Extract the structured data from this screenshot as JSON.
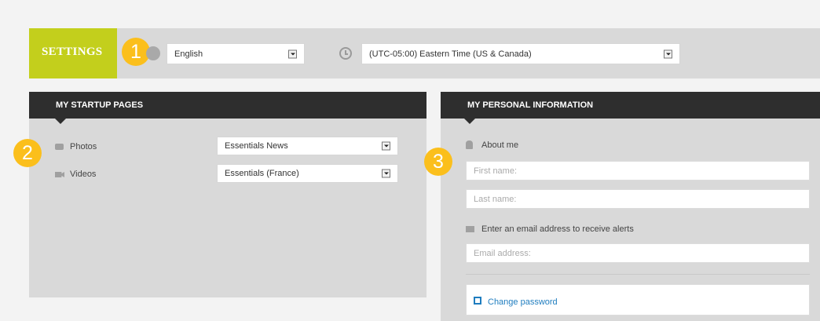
{
  "header": {
    "settings_label": "SETTINGS",
    "language": {
      "value": "English",
      "icon": "globe-icon"
    },
    "timezone": {
      "value": "(UTC-05:00) Eastern Time (US & Canada)",
      "icon": "clock-icon"
    }
  },
  "badges": [
    "1",
    "2",
    "3"
  ],
  "startup": {
    "title": "MY STARTUP PAGES",
    "rows": [
      {
        "label": "Photos",
        "icon": "camera-icon",
        "value": "Essentials News"
      },
      {
        "label": "Videos",
        "icon": "video-icon",
        "value": "Essentials (France)"
      }
    ]
  },
  "personal": {
    "title": "MY PERSONAL INFORMATION",
    "about_label": "About me",
    "first_name_placeholder": "First name:",
    "last_name_placeholder": "Last name:",
    "email_label": "Enter an email address to receive alerts",
    "email_placeholder": "Email address:",
    "change_password": "Change password"
  },
  "colors": {
    "accent": "#c3cf1c",
    "badge": "#fbbf1c",
    "panel_header": "#2e2e2e",
    "link": "#1f7dbf"
  }
}
